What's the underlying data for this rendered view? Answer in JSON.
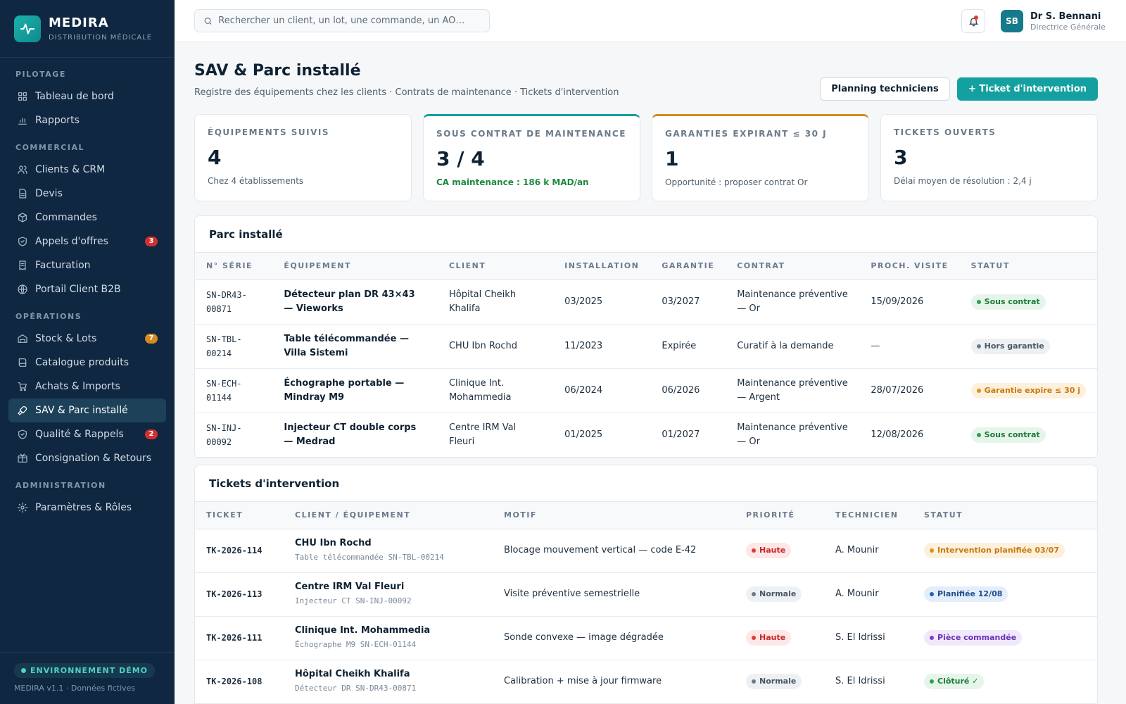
{
  "brand": {
    "name": "MEDIRA",
    "subtitle": "DISTRIBUTION MÉDICALE"
  },
  "nav": {
    "sections": [
      {
        "title": "PILOTAGE",
        "items": [
          {
            "label": "Tableau de bord",
            "icon": "grid-icon"
          },
          {
            "label": "Rapports",
            "icon": "bar-chart-icon"
          }
        ]
      },
      {
        "title": "COMMERCIAL",
        "items": [
          {
            "label": "Clients & CRM",
            "icon": "users-icon"
          },
          {
            "label": "Devis",
            "icon": "document-icon"
          },
          {
            "label": "Commandes",
            "icon": "box-icon"
          },
          {
            "label": "Appels d'offres",
            "icon": "shield-icon",
            "badge": "3",
            "badge_color": "#d32f2f"
          },
          {
            "label": "Facturation",
            "icon": "receipt-icon"
          },
          {
            "label": "Portail Client B2B",
            "icon": "globe-icon"
          }
        ]
      },
      {
        "title": "OPÉRATIONS",
        "items": [
          {
            "label": "Stock & Lots",
            "icon": "warehouse-icon",
            "badge": "7",
            "badge_color": "#d38b22"
          },
          {
            "label": "Catalogue produits",
            "icon": "book-icon"
          },
          {
            "label": "Achats & Imports",
            "icon": "cart-icon"
          },
          {
            "label": "SAV & Parc installé",
            "icon": "wrench-icon",
            "active": true
          },
          {
            "label": "Qualité & Rappels",
            "icon": "shield-icon",
            "badge": "2",
            "badge_color": "#d32f2f"
          },
          {
            "label": "Consignation & Retours",
            "icon": "package-icon"
          }
        ]
      },
      {
        "title": "ADMINISTRATION",
        "items": [
          {
            "label": "Paramètres & Rôles",
            "icon": "gear-icon"
          }
        ]
      }
    ]
  },
  "footer": {
    "env": "ENVIRONNEMENT DÉMO",
    "version": "MEDIRA v1.1 · Données fictives"
  },
  "topbar": {
    "search_placeholder": "Rechercher un client, un lot, une commande, un AO…",
    "user": {
      "initials": "SB",
      "name": "Dr S. Bennani",
      "role": "Directrice Générale"
    }
  },
  "page": {
    "title": "SAV & Parc installé",
    "subtitle": "Registre des équipements chez les clients · Contrats de maintenance · Tickets d'intervention",
    "btn_planning": "Planning techniciens",
    "btn_ticket": "+ Ticket d'intervention"
  },
  "kpis": [
    {
      "label": "ÉQUIPEMENTS SUIVIS",
      "value": "4",
      "note": "Chez 4 établissements"
    },
    {
      "label": "SOUS CONTRAT DE MAINTENANCE",
      "value": "3 / 4",
      "note": "CA maintenance : 186 k MAD/an"
    },
    {
      "label": "GARANTIES EXPIRANT ≤ 30 J",
      "value": "1",
      "note": "Opportunité : proposer contrat Or"
    },
    {
      "label": "TICKETS OUVERTS",
      "value": "3",
      "note": "Délai moyen de résolution : 2,4 j"
    }
  ],
  "parc": {
    "title": "Parc installé",
    "columns": [
      "N° SÉRIE",
      "ÉQUIPEMENT",
      "CLIENT",
      "INSTALLATION",
      "GARANTIE",
      "CONTRAT",
      "PROCH. VISITE",
      "STATUT"
    ],
    "rows": [
      {
        "serial": "SN-DR43-00871",
        "equipment": "Détecteur plan DR 43×43 — Vieworks",
        "client": "Hôpital Cheikh Khalifa",
        "install": "03/2025",
        "warranty": "03/2027",
        "contract": "Maintenance préventive — Or",
        "next_visit": "15/09/2026",
        "status": "Sous contrat",
        "status_color": "green"
      },
      {
        "serial": "SN-TBL-00214",
        "equipment": "Table télécommandée — Villa Sistemi",
        "client": "CHU Ibn Rochd",
        "install": "11/2023",
        "warranty": "Expirée",
        "contract": "Curatif à la demande",
        "next_visit": "—",
        "status": "Hors garantie",
        "status_color": "gray"
      },
      {
        "serial": "SN-ECH-01144",
        "equipment": "Échographe portable — Mindray M9",
        "client": "Clinique Int. Mohammedia",
        "install": "06/2024",
        "warranty": "06/2026",
        "contract": "Maintenance préventive — Argent",
        "next_visit": "28/07/2026",
        "status": "Garantie expire ≤ 30 j",
        "status_color": "orange"
      },
      {
        "serial": "SN-INJ-00092",
        "equipment": "Injecteur CT double corps — Medrad",
        "client": "Centre IRM Val Fleuri",
        "install": "01/2025",
        "warranty": "01/2027",
        "contract": "Maintenance préventive — Or",
        "next_visit": "12/08/2026",
        "status": "Sous contrat",
        "status_color": "green"
      }
    ]
  },
  "tickets": {
    "title": "Tickets d'intervention",
    "columns": [
      "TICKET",
      "CLIENT / ÉQUIPEMENT",
      "MOTIF",
      "PRIORITÉ",
      "TECHNICIEN",
      "STATUT"
    ],
    "rows": [
      {
        "id": "TK-2026-114",
        "client": "CHU Ibn Rochd",
        "equipment": "Table télécommandée SN-TBL-00214",
        "motif": "Blocage mouvement vertical — code E-42",
        "priority": "Haute",
        "priority_color": "red",
        "tech": "A. Mounir",
        "status": "Intervention planifiée 03/07",
        "status_color": "orange"
      },
      {
        "id": "TK-2026-113",
        "client": "Centre IRM Val Fleuri",
        "equipment": "Injecteur CT SN-INJ-00092",
        "motif": "Visite préventive semestrielle",
        "priority": "Normale",
        "priority_color": "gray",
        "tech": "A. Mounir",
        "status": "Planifiée 12/08",
        "status_color": "blue"
      },
      {
        "id": "TK-2026-111",
        "client": "Clinique Int. Mohammedia",
        "equipment": "Échographe M9 SN-ECH-01144",
        "motif": "Sonde convexe — image dégradée",
        "priority": "Haute",
        "priority_color": "red",
        "tech": "S. El Idrissi",
        "status": "Pièce commandée",
        "status_color": "purple"
      },
      {
        "id": "TK-2026-108",
        "client": "Hôpital Cheikh Khalifa",
        "equipment": "Détecteur DR SN-DR43-00871",
        "motif": "Calibration + mise à jour firmware",
        "priority": "Normale",
        "priority_color": "gray",
        "tech": "S. El Idrissi",
        "status": "Clôturé ✓",
        "status_color": "green"
      }
    ]
  }
}
